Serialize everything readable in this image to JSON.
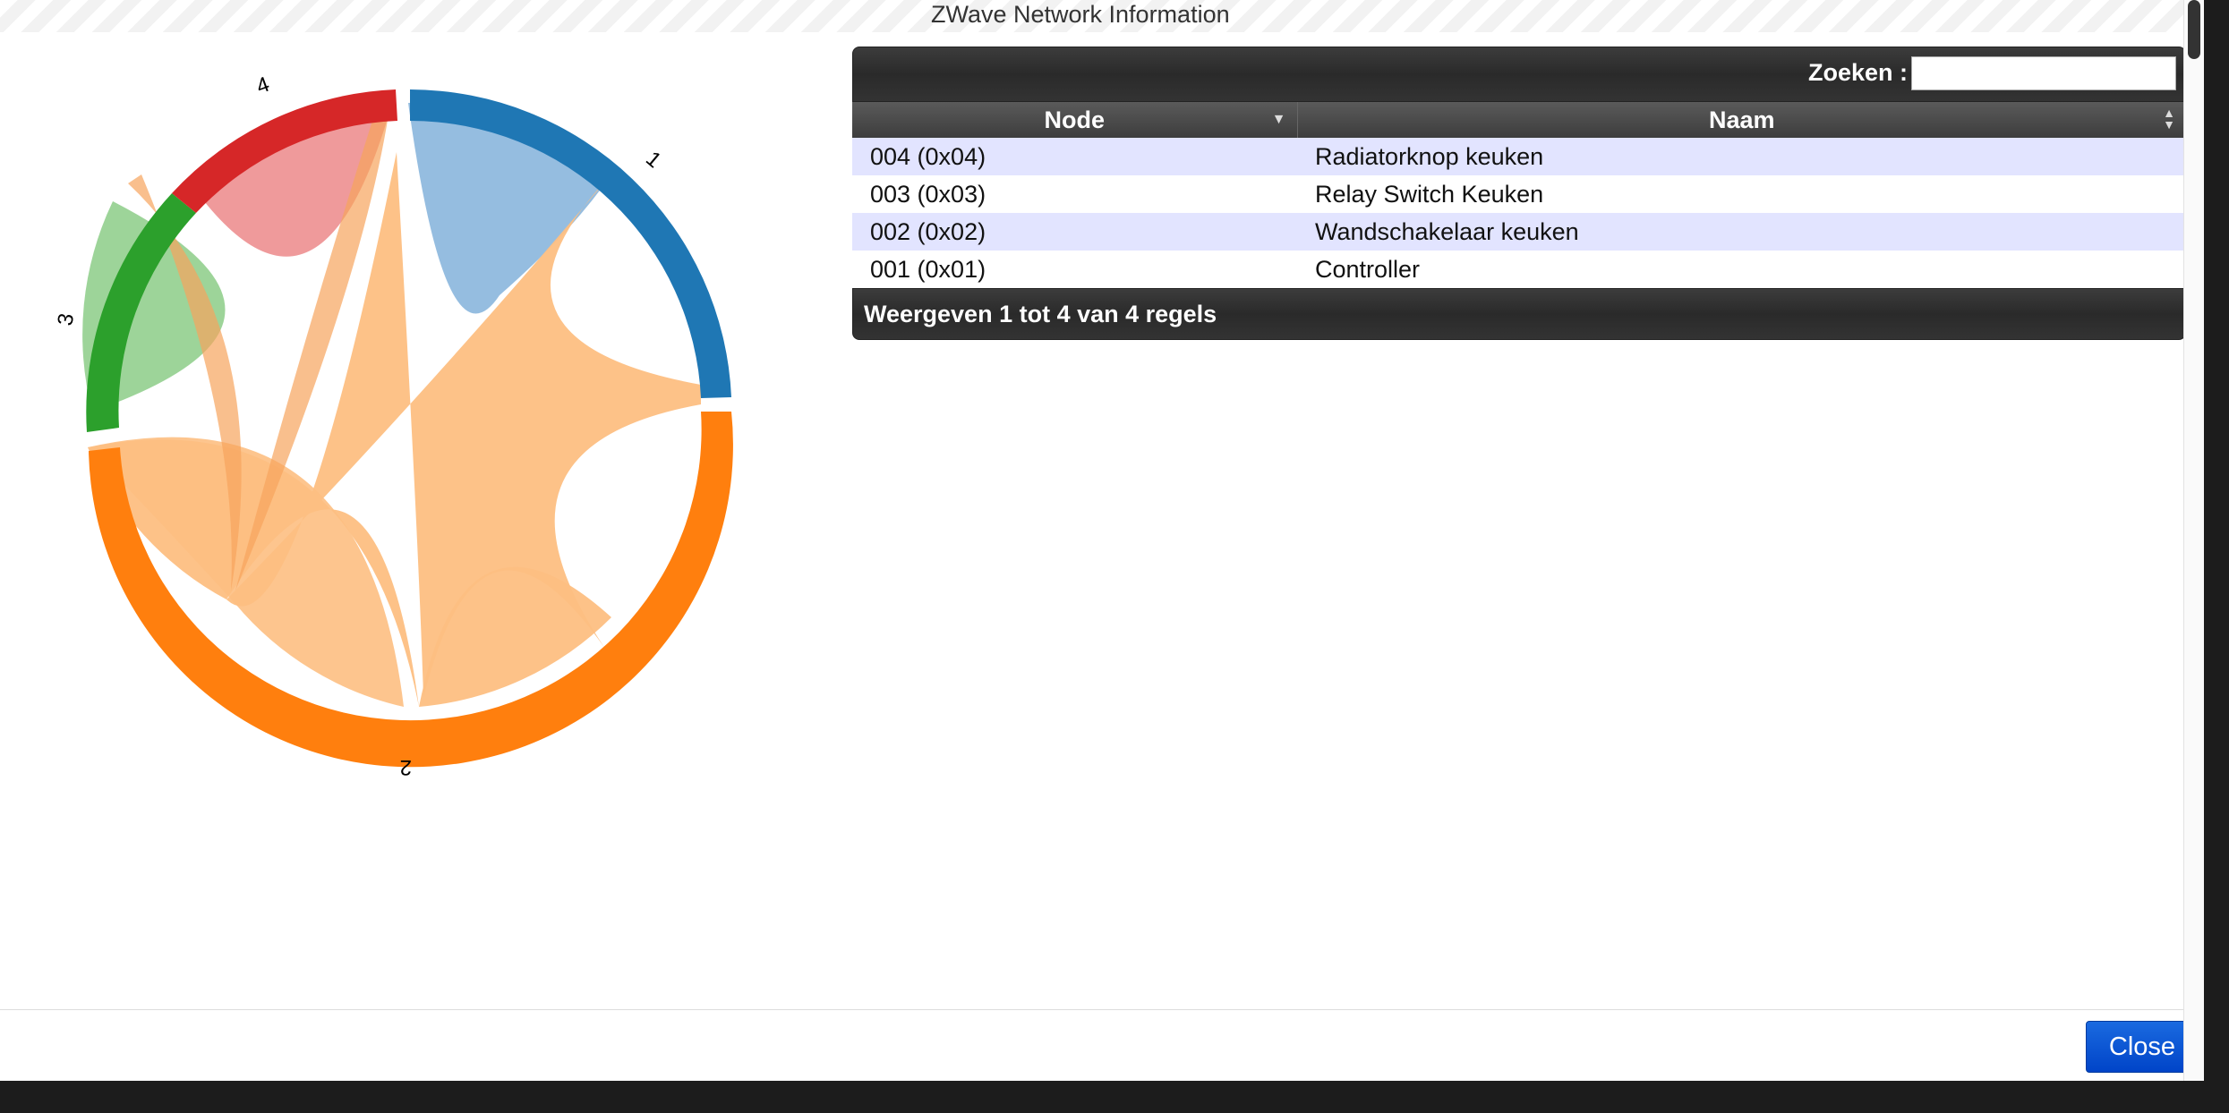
{
  "dialog": {
    "title": "ZWave Network Information"
  },
  "chord": {
    "groups": [
      {
        "label": "1",
        "color": "#1f77b4",
        "chord_color": "#8fb9de"
      },
      {
        "label": "2",
        "color": "#ff7f0e",
        "chord_color": "#fdbf82"
      },
      {
        "label": "3",
        "color": "#2ca02c",
        "chord_color": "#98d294"
      },
      {
        "label": "4",
        "color": "#d62728",
        "chord_color": "#ee9596"
      }
    ]
  },
  "table": {
    "search_label": "Zoeken :",
    "search_value": "",
    "columns": [
      "Node",
      "Naam"
    ],
    "rows": [
      {
        "node": "004 (0x04)",
        "name": "Radiatorknop keuken"
      },
      {
        "node": "003 (0x03)",
        "name": "Relay Switch Keuken"
      },
      {
        "node": "002 (0x02)",
        "name": "Wandschakelaar keuken"
      },
      {
        "node": "001 (0x01)",
        "name": "Controller"
      }
    ],
    "info": "Weergeven 1 tot 4 van 4 regels"
  },
  "footer": {
    "close_label": "Close"
  }
}
